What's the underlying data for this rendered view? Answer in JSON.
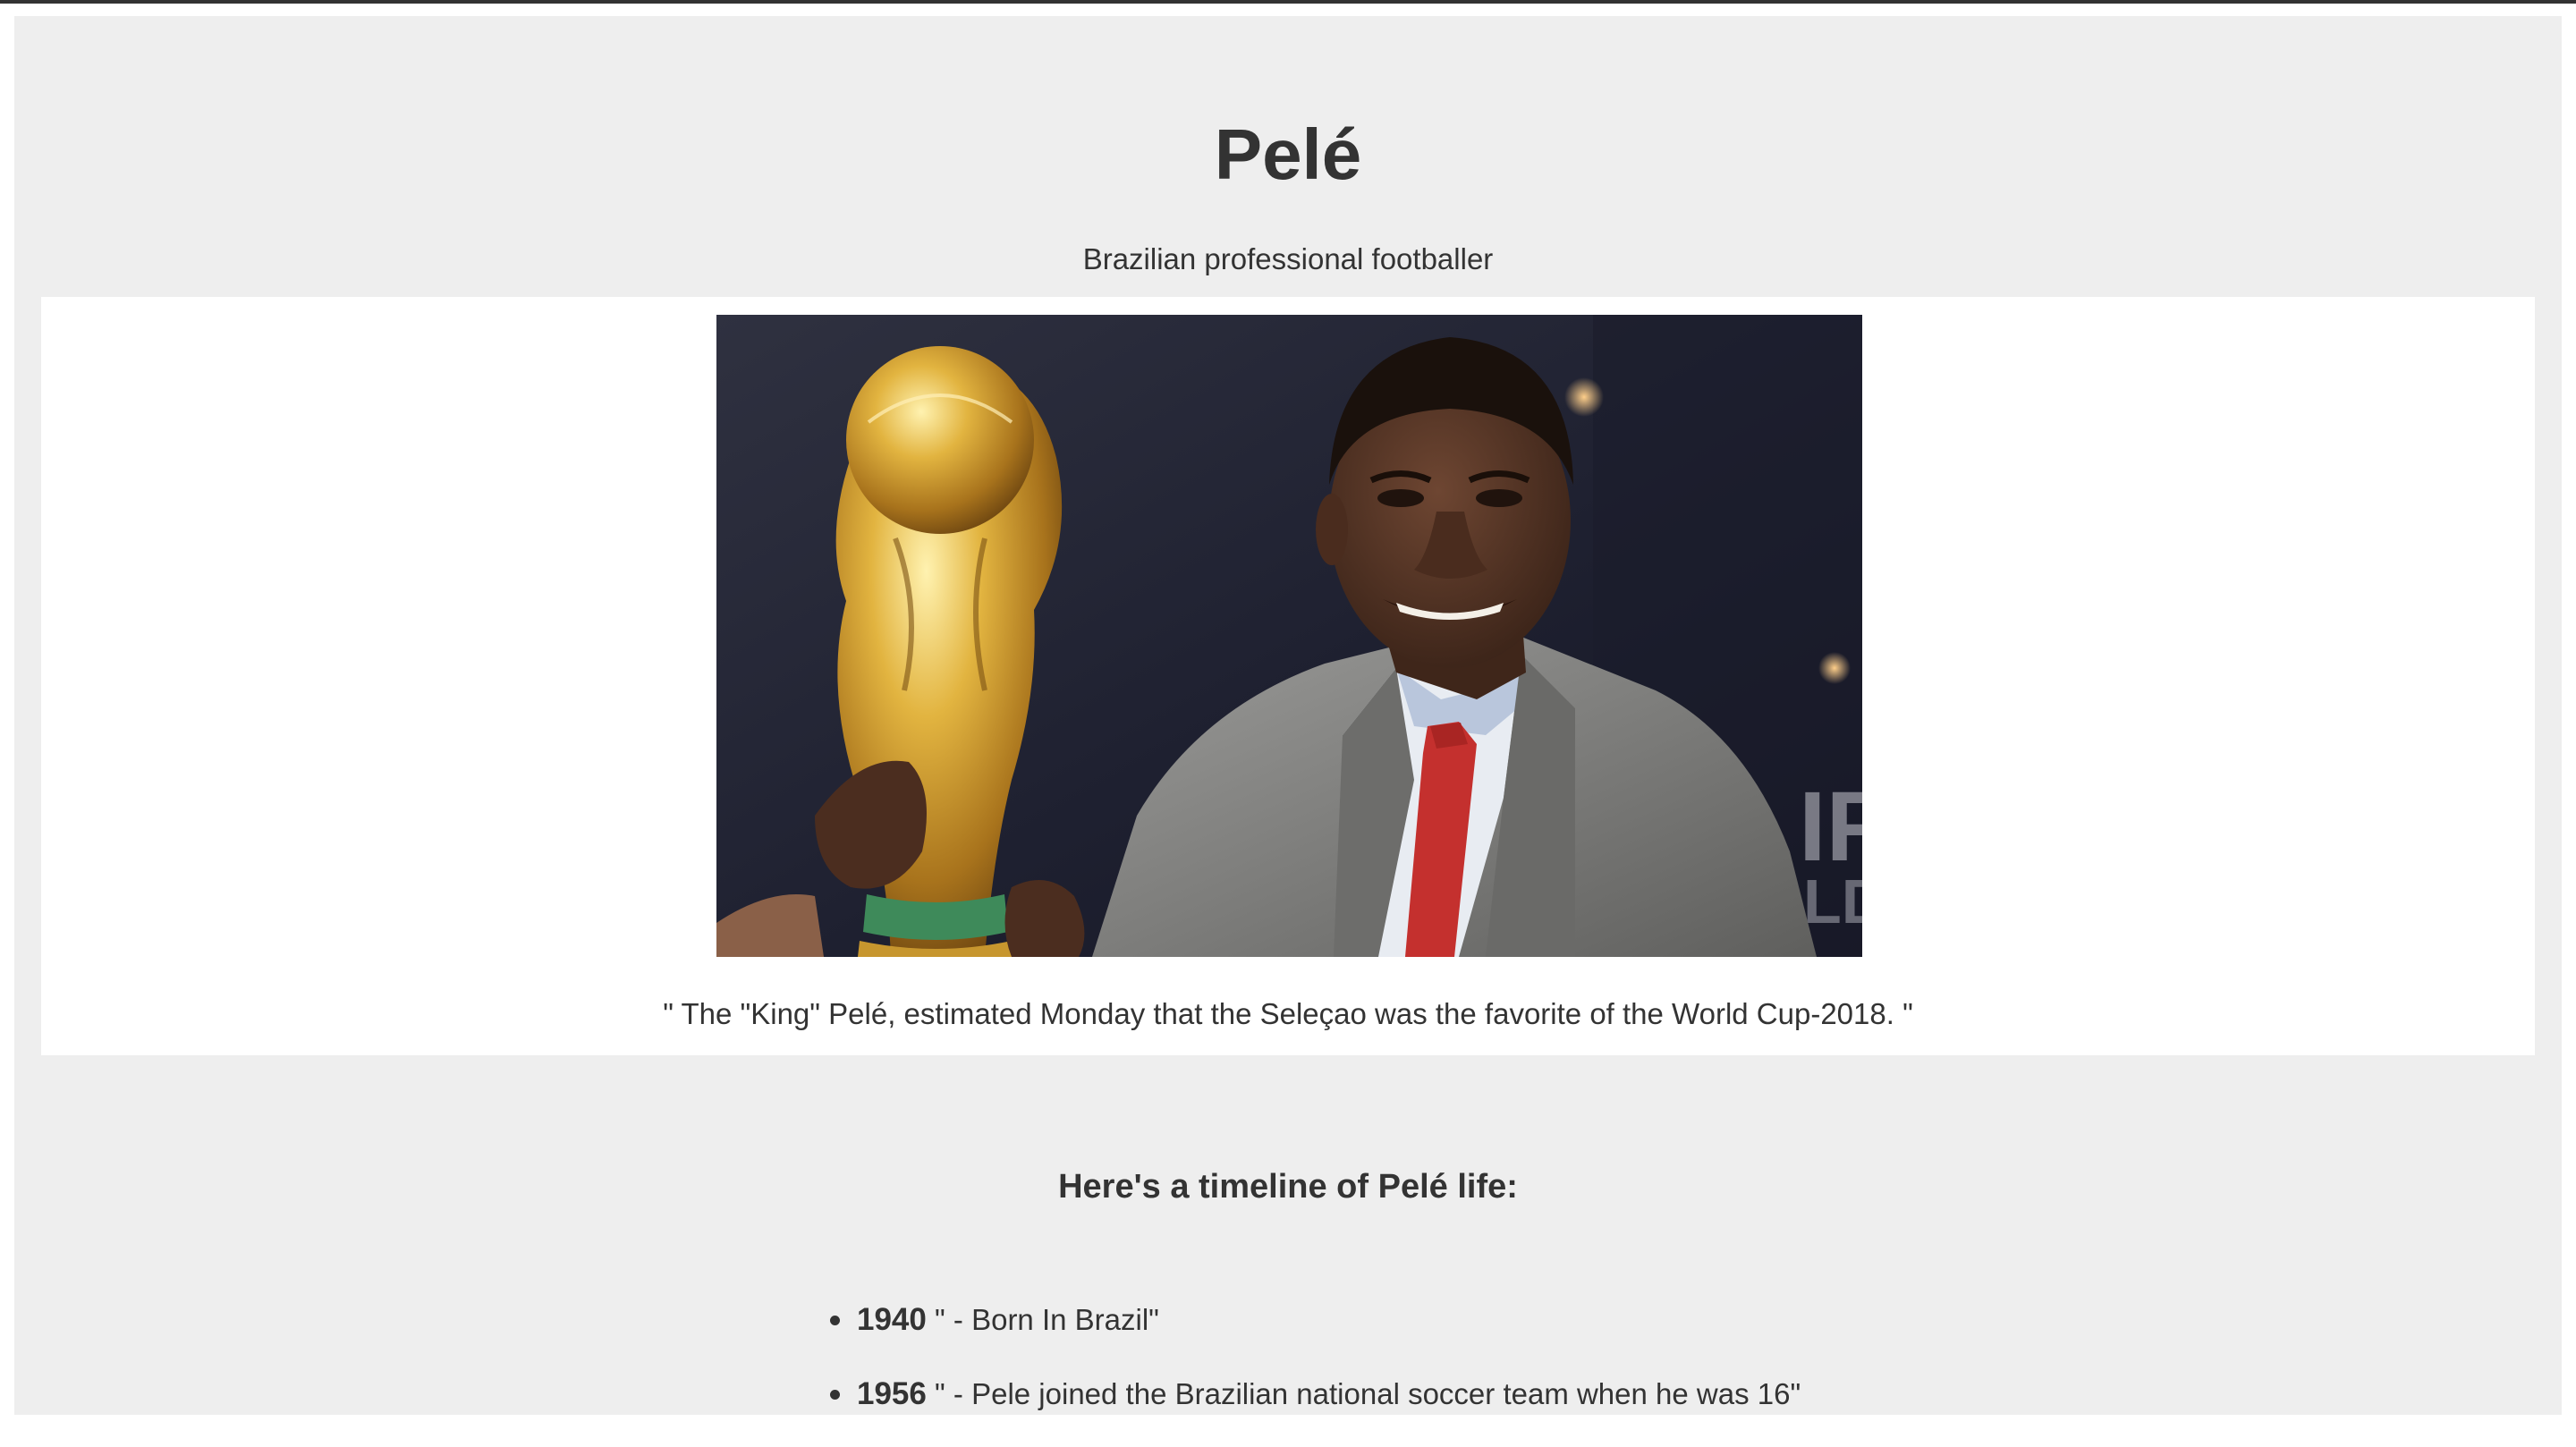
{
  "page": {
    "title": "Pelé",
    "subtitle": "Brazilian professional footballer"
  },
  "image": {
    "caption": "\" The \"King\" Pelé, estimated Monday that the Seleçao was the favorite of the World Cup-2018. \""
  },
  "timeline": {
    "heading": "Here's a timeline of Pelé life:",
    "items": [
      {
        "year": "1940",
        "text": " \" - Born In Brazil\""
      },
      {
        "year": "1956",
        "text": " \" - Pele joined the Brazilian national soccer team when he was 16\""
      }
    ]
  },
  "colors": {
    "background": "#eeeeee",
    "card": "#ffffff",
    "text": "#333333",
    "topbar": "#333333"
  }
}
